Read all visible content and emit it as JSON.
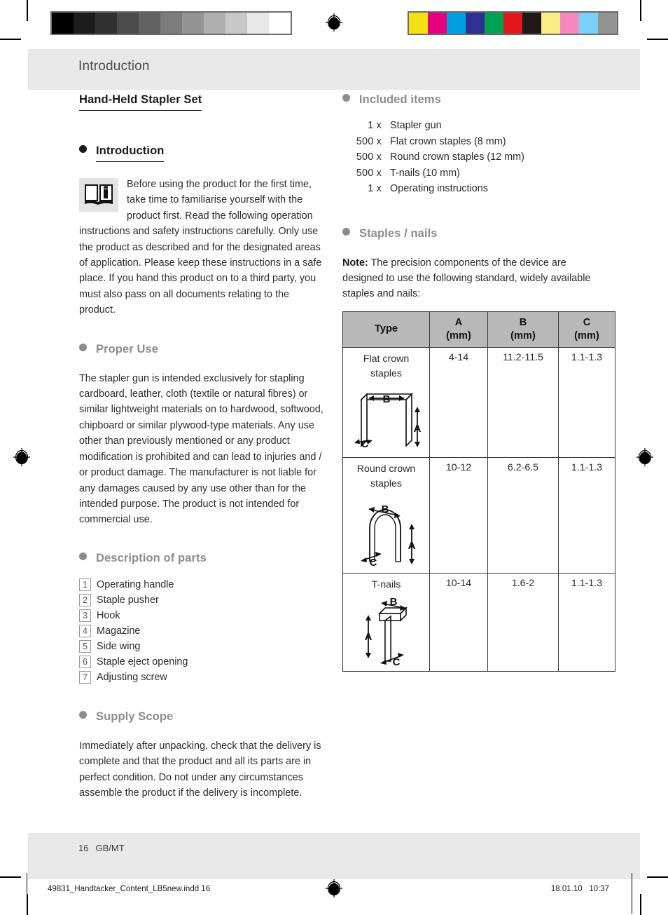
{
  "page": {
    "running_head": "Introduction",
    "doc_title": "Hand-Held Stapler Set",
    "folio_page": "16",
    "folio_locale": "GB/MT"
  },
  "imprint": {
    "filename": "49831_Handtacker_Content_LB5new.indd   16",
    "date": "18.01.10",
    "time": "10:37"
  },
  "sections": {
    "introduction": {
      "heading": "Introduction",
      "icon_name": "open-book-info-icon",
      "body": "Before using the product for the first time, take time to familiarise yourself with the product first. Read the following operation instructions and safety instructions carefully. Only use the product as described and for the designated areas of application. Please keep these instructions in a safe place. If you hand this product on to a third party, you must also pass on all documents relating to the product."
    },
    "proper_use": {
      "heading": "Proper Use",
      "body": "The stapler gun is intended exclusively for stapling cardboard, leather, cloth (textile or natural fibres) or similar lightweight materials on to hardwood, softwood, chipboard or similar plywood-type materials. Any use other than previously mentioned or any product modification is prohibited and can lead to injuries and / or product damage. The manufacturer is not liable for any damages caused by any use other than for the intended purpose. The product is not intended for commercial use."
    },
    "description_of_parts": {
      "heading": "Description of parts",
      "parts": [
        {
          "num": "1",
          "label": "Operating handle"
        },
        {
          "num": "2",
          "label": "Staple pusher"
        },
        {
          "num": "3",
          "label": "Hook"
        },
        {
          "num": "4",
          "label": "Magazine"
        },
        {
          "num": "5",
          "label": "Side wing"
        },
        {
          "num": "6",
          "label": "Staple eject opening"
        },
        {
          "num": "7",
          "label": "Adjusting screw"
        }
      ]
    },
    "supply_scope": {
      "heading": "Supply Scope",
      "body": "Immediately after unpacking, check that the delivery is complete and that the product and all its parts are in perfect condition. Do not under any circumstances assemble the product if the delivery is incomplete."
    },
    "included_items": {
      "heading": "Included items",
      "items": [
        {
          "qty": "1 x",
          "name": "Stapler gun"
        },
        {
          "qty": "500 x",
          "name": "Flat crown staples (8 mm)"
        },
        {
          "qty": "500 x",
          "name": "Round crown staples (12 mm)"
        },
        {
          "qty": "500 x",
          "name": "T-nails (10 mm)"
        },
        {
          "qty": "1 x",
          "name": "Operating instructions"
        }
      ]
    },
    "staples_nails": {
      "heading": "Staples / nails",
      "note_label": "Note:",
      "note_body": " The precision components of the device are designed to use the following standard, widely available staples and nails:"
    }
  },
  "spec_table": {
    "columns": [
      {
        "key": "type",
        "label": "Type",
        "unit": ""
      },
      {
        "key": "a",
        "label": "A",
        "unit": "(mm)"
      },
      {
        "key": "b",
        "label": "B",
        "unit": "(mm)"
      },
      {
        "key": "c",
        "label": "C",
        "unit": "(mm)"
      }
    ],
    "rows": [
      {
        "type": "Flat crown\nstaples",
        "type_line1": "Flat crown",
        "type_line2": "staples",
        "a": "4-14",
        "b": "11.2-11.5",
        "c": "1.1-1.3",
        "figure": "flat-crown-staple-diagram"
      },
      {
        "type_line1": "Round crown",
        "type_line2": "staples",
        "a": "10-12",
        "b": "6.2-6.5",
        "c": "1.1-1.3",
        "figure": "round-crown-staple-diagram"
      },
      {
        "type_line1": "T-nails",
        "type_line2": "",
        "a": "10-14",
        "b": "1.6-2",
        "c": "1.1-1.3",
        "figure": "t-nail-diagram"
      }
    ],
    "dimension_labels": [
      "A",
      "B",
      "C"
    ]
  },
  "print_marks": {
    "gray_bar": [
      "#000000",
      "#1c1c1c",
      "#303030",
      "#4b4b4b",
      "#626262",
      "#7d7d7d",
      "#949494",
      "#b0b0b0",
      "#c8c8c8",
      "#e8e8e8",
      "#ffffff"
    ],
    "color_bar": [
      "#f5e015",
      "#e4007f",
      "#00a0e2",
      "#2e3192",
      "#00a150",
      "#e3171c",
      "#1f1a18",
      "#faee84",
      "#f489bf",
      "#79d2f5",
      "#939393"
    ],
    "registration_icon": "registration-target-icon"
  },
  "colors": {
    "band": "#e8e8e8",
    "heading_gray": "#8c8c8c",
    "table_header": "#b8b8b8",
    "text": "#2b2b2b"
  }
}
